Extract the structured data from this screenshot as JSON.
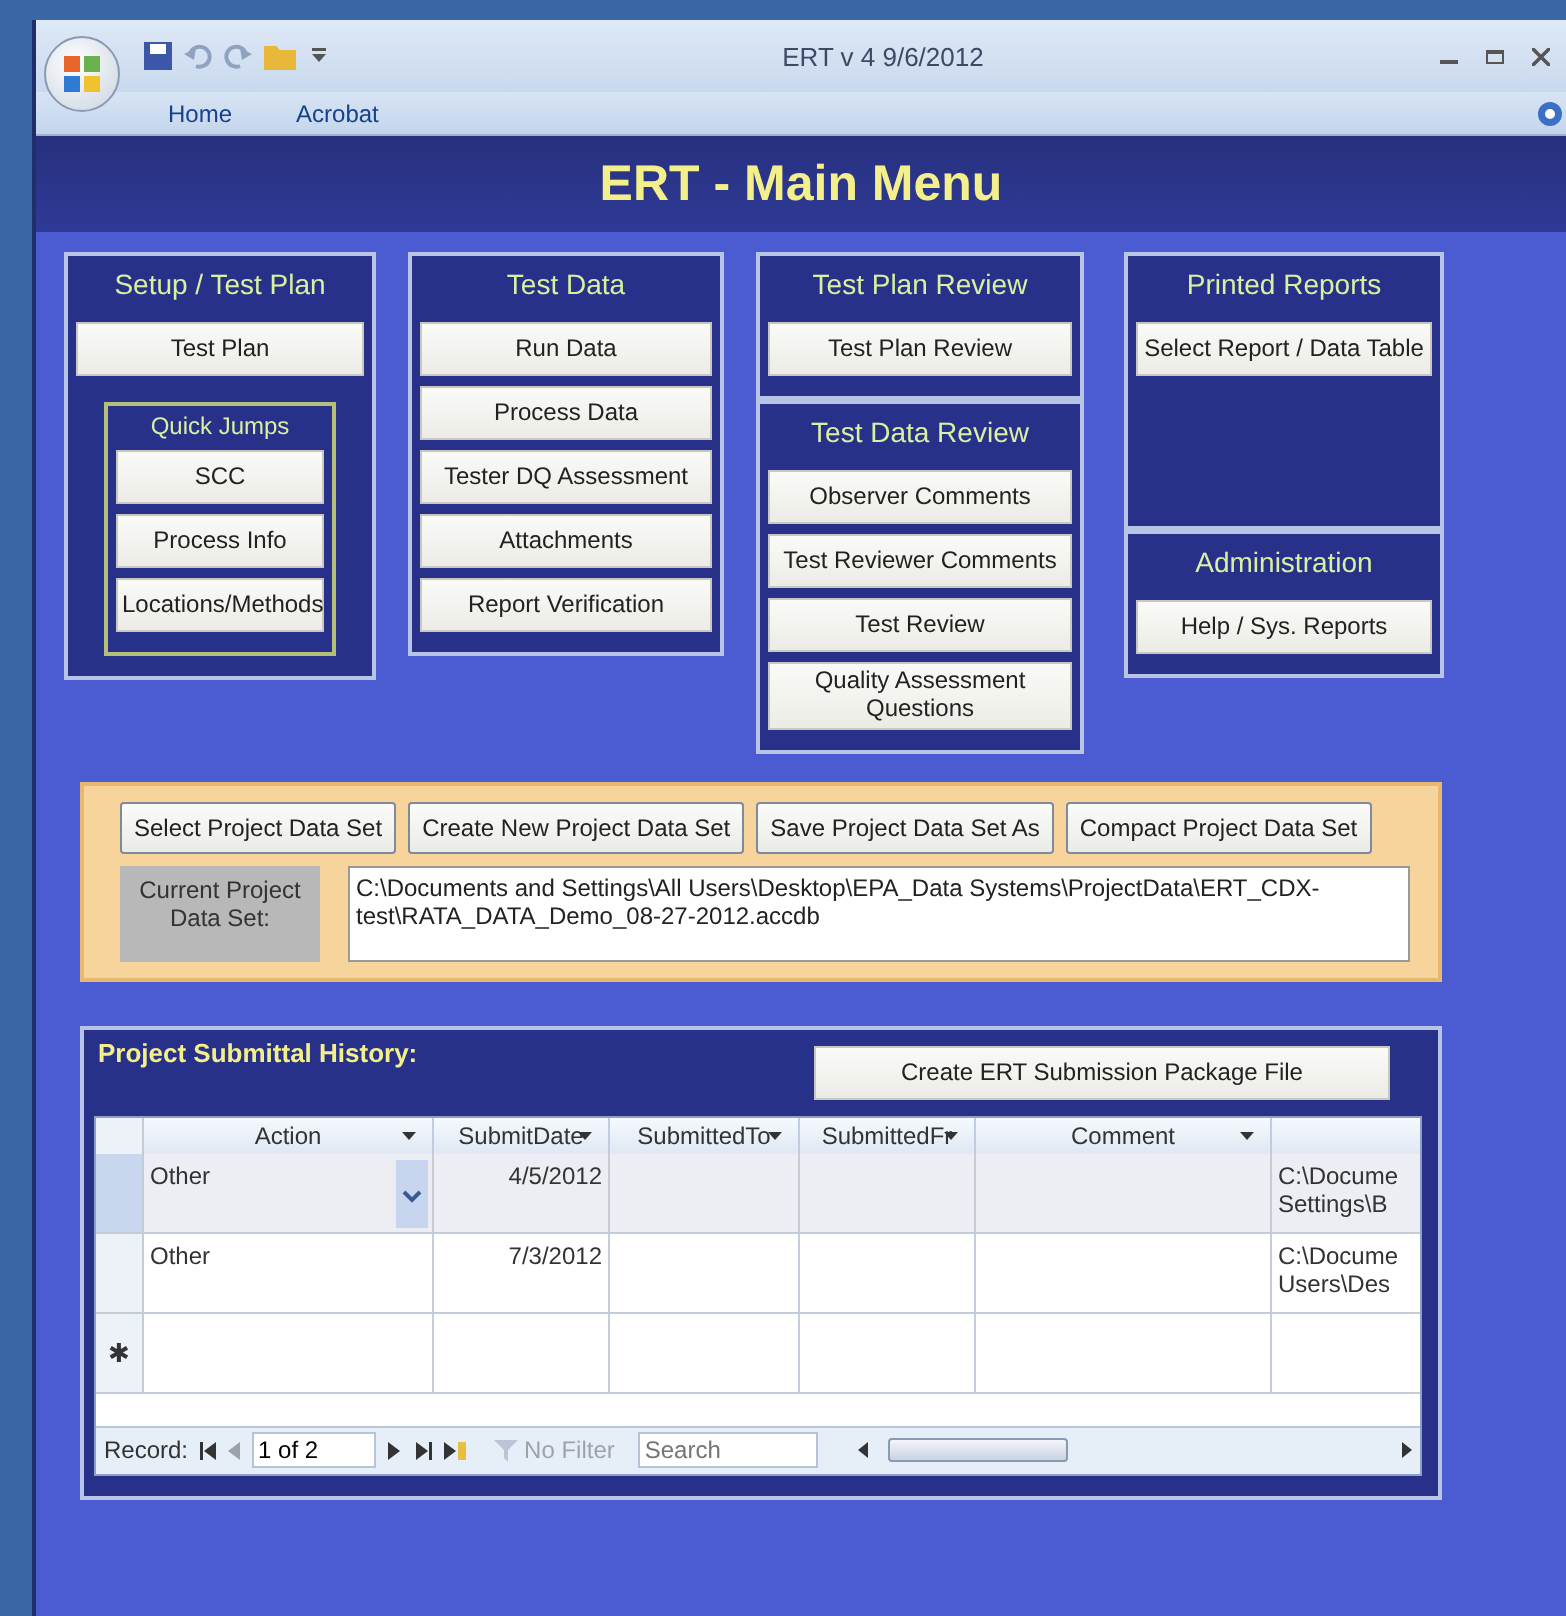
{
  "window": {
    "title": "ERT v 4  9/6/2012"
  },
  "ribbon_tabs": [
    {
      "label": "Home"
    },
    {
      "label": "Acrobat"
    }
  ],
  "form_title": "ERT - Main Menu",
  "menu_columns": [
    [
      {
        "title": "Setup / Test Plan",
        "buttons": [
          "Test Plan"
        ],
        "subgroup": {
          "title": "Quick Jumps",
          "buttons": [
            "SCC",
            "Process Info",
            "Locations/Methods"
          ]
        }
      }
    ],
    [
      {
        "title": "Test Data",
        "buttons": [
          "Run Data",
          "Process Data",
          "Tester DQ Assessment",
          "Attachments",
          "Report Verification"
        ]
      }
    ],
    [
      {
        "title": "Test Plan Review",
        "buttons": [
          "Test Plan Review"
        ]
      },
      {
        "title": "Test Data Review",
        "buttons": [
          "Observer Comments",
          "Test Reviewer Comments",
          "Test Review",
          "Quality Assessment Questions"
        ]
      }
    ],
    [
      {
        "title": "Printed Reports",
        "buttons": [
          "Select Report / Data Table"
        ]
      },
      {
        "title": "Administration",
        "buttons": [
          "Help / Sys. Reports"
        ]
      }
    ]
  ],
  "project_panel": {
    "buttons": [
      "Select Project Data Set",
      "Create New Project Data Set",
      "Save Project Data Set As",
      "Compact Project Data Set"
    ],
    "current_label": "Current Project Data Set:",
    "current_value": "C:\\Documents and Settings\\All Users\\Desktop\\EPA_Data Systems\\ProjectData\\ERT_CDX-test\\RATA_DATA_Demo_08-27-2012.accdb"
  },
  "history": {
    "title": "Project Submittal History:",
    "package_button": "Create ERT Submission Package File",
    "columns": [
      {
        "label": "Action"
      },
      {
        "label": "SubmitDate"
      },
      {
        "label": "SubmittedTo"
      },
      {
        "label": "SubmittedFr"
      },
      {
        "label": "Comment"
      },
      {}
    ],
    "rows": [
      {
        "selected": true,
        "cells": [
          "Other",
          "4/5/2012",
          "",
          "",
          "",
          "C:\\Docume\nSettings\\B"
        ]
      },
      {
        "selected": false,
        "cells": [
          "Other",
          "7/3/2012",
          "",
          "",
          "",
          "C:\\Docume\nUsers\\Des"
        ]
      }
    ],
    "new_row_marker": "✱",
    "navigation": {
      "label": "Record:",
      "position": "1 of 2",
      "filter": "No Filter",
      "search_placeholder": "Search"
    }
  }
}
